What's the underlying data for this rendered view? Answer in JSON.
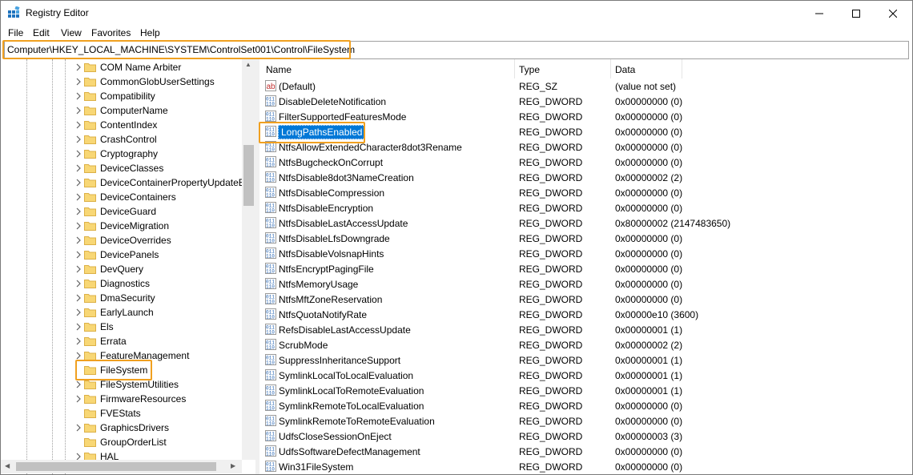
{
  "window": {
    "title": "Registry Editor",
    "controls": {
      "minimize": "—",
      "maximize": "☐",
      "close": "✕"
    }
  },
  "menu": [
    "File",
    "Edit",
    "View",
    "Favorites",
    "Help"
  ],
  "address": "Computer\\HKEY_LOCAL_MACHINE\\SYSTEM\\ControlSet001\\Control\\FileSystem",
  "tree": {
    "items": [
      {
        "label": "COM Name Arbiter",
        "expandable": true
      },
      {
        "label": "CommonGlobUserSettings",
        "expandable": true
      },
      {
        "label": "Compatibility",
        "expandable": true
      },
      {
        "label": "ComputerName",
        "expandable": true
      },
      {
        "label": "ContentIndex",
        "expandable": true
      },
      {
        "label": "CrashControl",
        "expandable": true
      },
      {
        "label": "Cryptography",
        "expandable": true
      },
      {
        "label": "DeviceClasses",
        "expandable": true
      },
      {
        "label": "DeviceContainerPropertyUpdateE",
        "expandable": true
      },
      {
        "label": "DeviceContainers",
        "expandable": true
      },
      {
        "label": "DeviceGuard",
        "expandable": true
      },
      {
        "label": "DeviceMigration",
        "expandable": true
      },
      {
        "label": "DeviceOverrides",
        "expandable": true
      },
      {
        "label": "DevicePanels",
        "expandable": true
      },
      {
        "label": "DevQuery",
        "expandable": true
      },
      {
        "label": "Diagnostics",
        "expandable": true
      },
      {
        "label": "DmaSecurity",
        "expandable": true
      },
      {
        "label": "EarlyLaunch",
        "expandable": true
      },
      {
        "label": "Els",
        "expandable": true
      },
      {
        "label": "Errata",
        "expandable": true
      },
      {
        "label": "FeatureManagement",
        "expandable": true
      },
      {
        "label": "FileSystem",
        "expandable": false,
        "selected": true
      },
      {
        "label": "FileSystemUtilities",
        "expandable": true
      },
      {
        "label": "FirmwareResources",
        "expandable": true
      },
      {
        "label": "FVEStats",
        "expandable": false
      },
      {
        "label": "GraphicsDrivers",
        "expandable": true
      },
      {
        "label": "GroupOrderList",
        "expandable": false
      },
      {
        "label": "HAL",
        "expandable": true
      }
    ]
  },
  "list": {
    "columns": {
      "name": "Name",
      "type": "Type",
      "data": "Data"
    },
    "rows": [
      {
        "name": "(Default)",
        "type": "REG_SZ",
        "data": "(value not set)",
        "icon": "string-value-icon"
      },
      {
        "name": "DisableDeleteNotification",
        "type": "REG_DWORD",
        "data": "0x00000000 (0)",
        "icon": "binary-value-icon"
      },
      {
        "name": "FilterSupportedFeaturesMode",
        "type": "REG_DWORD",
        "data": "0x00000000 (0)",
        "icon": "binary-value-icon"
      },
      {
        "name": "LongPathsEnabled",
        "type": "REG_DWORD",
        "data": "0x00000000 (0)",
        "icon": "binary-value-icon",
        "selected": true
      },
      {
        "name": "NtfsAllowExtendedCharacter8dot3Rename",
        "type": "REG_DWORD",
        "data": "0x00000000 (0)",
        "icon": "binary-value-icon"
      },
      {
        "name": "NtfsBugcheckOnCorrupt",
        "type": "REG_DWORD",
        "data": "0x00000000 (0)",
        "icon": "binary-value-icon"
      },
      {
        "name": "NtfsDisable8dot3NameCreation",
        "type": "REG_DWORD",
        "data": "0x00000002 (2)",
        "icon": "binary-value-icon"
      },
      {
        "name": "NtfsDisableCompression",
        "type": "REG_DWORD",
        "data": "0x00000000 (0)",
        "icon": "binary-value-icon"
      },
      {
        "name": "NtfsDisableEncryption",
        "type": "REG_DWORD",
        "data": "0x00000000 (0)",
        "icon": "binary-value-icon"
      },
      {
        "name": "NtfsDisableLastAccessUpdate",
        "type": "REG_DWORD",
        "data": "0x80000002 (2147483650)",
        "icon": "binary-value-icon"
      },
      {
        "name": "NtfsDisableLfsDowngrade",
        "type": "REG_DWORD",
        "data": "0x00000000 (0)",
        "icon": "binary-value-icon"
      },
      {
        "name": "NtfsDisableVolsnapHints",
        "type": "REG_DWORD",
        "data": "0x00000000 (0)",
        "icon": "binary-value-icon"
      },
      {
        "name": "NtfsEncryptPagingFile",
        "type": "REG_DWORD",
        "data": "0x00000000 (0)",
        "icon": "binary-value-icon"
      },
      {
        "name": "NtfsMemoryUsage",
        "type": "REG_DWORD",
        "data": "0x00000000 (0)",
        "icon": "binary-value-icon"
      },
      {
        "name": "NtfsMftZoneReservation",
        "type": "REG_DWORD",
        "data": "0x00000000 (0)",
        "icon": "binary-value-icon"
      },
      {
        "name": "NtfsQuotaNotifyRate",
        "type": "REG_DWORD",
        "data": "0x00000e10 (3600)",
        "icon": "binary-value-icon"
      },
      {
        "name": "RefsDisableLastAccessUpdate",
        "type": "REG_DWORD",
        "data": "0x00000001 (1)",
        "icon": "binary-value-icon"
      },
      {
        "name": "ScrubMode",
        "type": "REG_DWORD",
        "data": "0x00000002 (2)",
        "icon": "binary-value-icon"
      },
      {
        "name": "SuppressInheritanceSupport",
        "type": "REG_DWORD",
        "data": "0x00000001 (1)",
        "icon": "binary-value-icon"
      },
      {
        "name": "SymlinkLocalToLocalEvaluation",
        "type": "REG_DWORD",
        "data": "0x00000001 (1)",
        "icon": "binary-value-icon"
      },
      {
        "name": "SymlinkLocalToRemoteEvaluation",
        "type": "REG_DWORD",
        "data": "0x00000001 (1)",
        "icon": "binary-value-icon"
      },
      {
        "name": "SymlinkRemoteToLocalEvaluation",
        "type": "REG_DWORD",
        "data": "0x00000000 (0)",
        "icon": "binary-value-icon"
      },
      {
        "name": "SymlinkRemoteToRemoteEvaluation",
        "type": "REG_DWORD",
        "data": "0x00000000 (0)",
        "icon": "binary-value-icon"
      },
      {
        "name": "UdfsCloseSessionOnEject",
        "type": "REG_DWORD",
        "data": "0x00000003 (3)",
        "icon": "binary-value-icon"
      },
      {
        "name": "UdfsSoftwareDefectManagement",
        "type": "REG_DWORD",
        "data": "0x00000000 (0)",
        "icon": "binary-value-icon"
      },
      {
        "name": "Win31FileSystem",
        "type": "REG_DWORD",
        "data": "0x00000000 (0)",
        "icon": "binary-value-icon"
      }
    ]
  },
  "colors": {
    "highlight": "#f0a020",
    "selection": "#0078d7",
    "folder": "#f8d775"
  }
}
